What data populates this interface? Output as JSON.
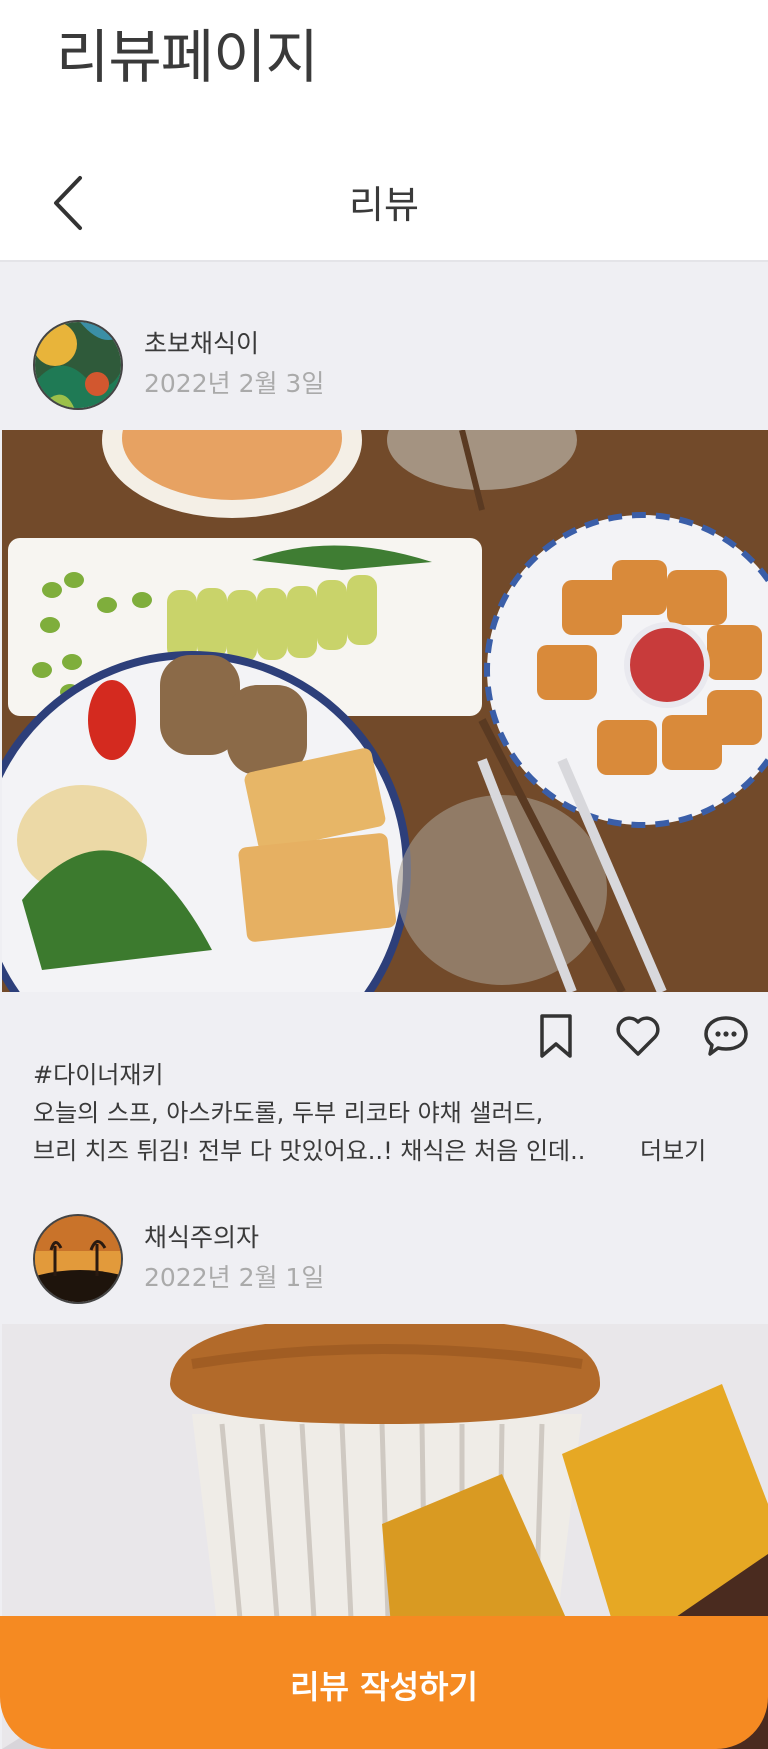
{
  "page": {
    "heading": "리뷰페이지"
  },
  "navbar": {
    "title": "리뷰",
    "back_icon": "chevron-left-icon"
  },
  "reviews": [
    {
      "author": "초보채식이",
      "date": "2022년 2월 3일",
      "hashtag": "#다이너재키",
      "text_line1": "오늘의 스프, 아스카도롤, 두부 리코타 야채 샐러드,",
      "text_line2": "브리 치즈 튀김! 전부 다 맛있어요..! 채식은 처음 인데..",
      "more_label": "더보기",
      "actions": [
        "bookmark-icon",
        "heart-icon",
        "comment-icon"
      ]
    },
    {
      "author": "채식주의자",
      "date": "2022년 2월 1일"
    }
  ],
  "write_button": {
    "label": "리뷰 작성하기"
  },
  "colors": {
    "accent": "#f58a22",
    "feed_bg": "#efeff3",
    "date": "#aaaaaa"
  }
}
